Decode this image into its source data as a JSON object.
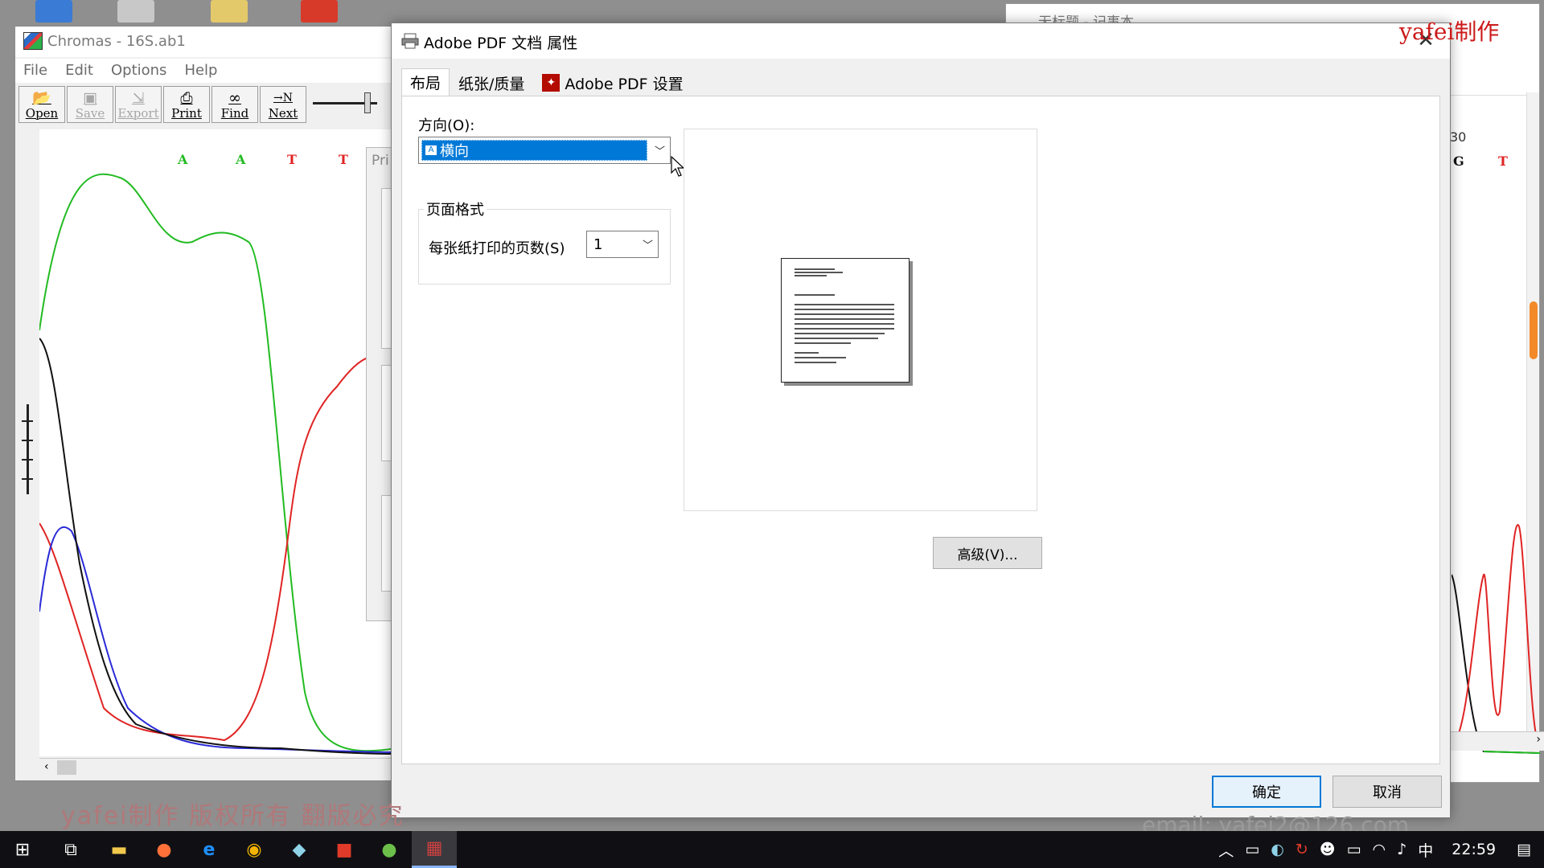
{
  "notepad": {
    "title": "无标题 - 记事本"
  },
  "chromas": {
    "title": "Chromas - 16S.ab1",
    "menu": [
      "File",
      "Edit",
      "Options",
      "Help"
    ],
    "toolbar": [
      {
        "label": "Open",
        "enabled": true,
        "icon": "folder-open-icon"
      },
      {
        "label": "Save",
        "enabled": false,
        "icon": "floppy-icon"
      },
      {
        "label": "Export",
        "enabled": false,
        "icon": "export-icon"
      },
      {
        "label": "Print",
        "enabled": true,
        "icon": "printer-icon"
      },
      {
        "label": "Find",
        "enabled": true,
        "icon": "binoculars-icon"
      },
      {
        "label": "Next",
        "enabled": true,
        "icon": "next-arrow-icon"
      }
    ],
    "bases": [
      "A",
      "A",
      "T",
      "T"
    ],
    "right_bases": [
      "G",
      "T"
    ],
    "right_position": "30",
    "pri_label": "Pri"
  },
  "dialog": {
    "title": "Adobe PDF 文档 属性",
    "tabs": [
      "布局",
      "纸张/质量",
      "Adobe PDF 设置"
    ],
    "orientation_label": "方向(O):",
    "orientation_value": "横向",
    "page_format_label": "页面格式",
    "pages_per_sheet_label": "每张纸打印的页数(S)",
    "pages_per_sheet_value": "1",
    "advanced_button": "高级(V)...",
    "ok_button": "确定",
    "cancel_button": "取消"
  },
  "watermark": {
    "top_right": "yafei制作",
    "bottom": "yafei制作 版权所有 翻版必究",
    "email": "email: yafei2@126.com"
  },
  "taskbar": {
    "apps": [
      "start-icon",
      "task-view-icon",
      "file-explorer-icon",
      "firefox-icon",
      "edge-icon",
      "chrome-icon",
      "app-icon",
      "office-icon",
      "green-app-icon",
      "chromas-icon"
    ],
    "ime": "中",
    "time": "22:59"
  },
  "colors": {
    "accent": "#0078d7",
    "trace_green": "#22bb22",
    "trace_red": "#e02424",
    "trace_blue": "#2a2ad8",
    "trace_black": "#111111",
    "watermark_red": "#cc1a1a"
  }
}
